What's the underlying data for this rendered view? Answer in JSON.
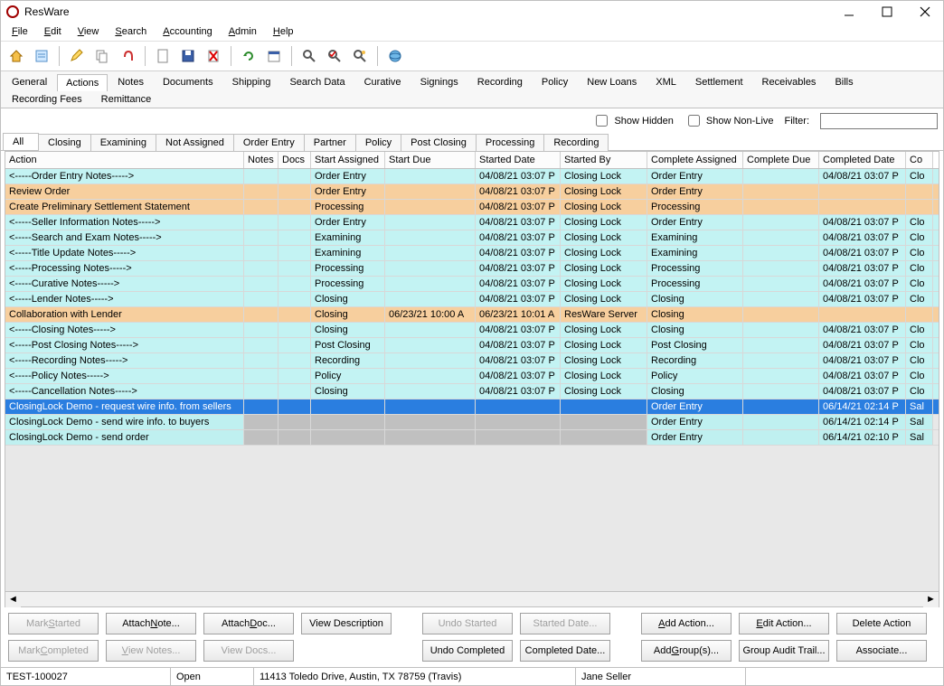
{
  "title": "ResWare",
  "menus": [
    "File",
    "Edit",
    "View",
    "Search",
    "Accounting",
    "Admin",
    "Help"
  ],
  "main_tabs": [
    "General",
    "Actions",
    "Notes",
    "Documents",
    "Shipping",
    "Search Data",
    "Curative",
    "Signings",
    "Recording",
    "Policy",
    "New Loans",
    "XML",
    "Settlement",
    "Receivables",
    "Bills",
    "Recording Fees",
    "Remittance"
  ],
  "active_main_tab": "Actions",
  "filterbar": {
    "show_hidden": "Show Hidden",
    "show_nonlive": "Show Non-Live",
    "filter_label": "Filter:",
    "filter_value": ""
  },
  "sub_tabs": [
    "All",
    "Closing",
    "Examining",
    "Not Assigned",
    "Order Entry",
    "Partner",
    "Policy",
    "Post Closing",
    "Processing",
    "Recording"
  ],
  "active_sub_tab": "All",
  "columns": [
    "Action",
    "Notes",
    "Docs",
    "Start Assigned",
    "Start Due",
    "Started Date",
    "Started By",
    "Complete Assigned",
    "Complete Due",
    "Completed Date",
    "Co"
  ],
  "rows": [
    {
      "cls": "row-teal",
      "action": "<-----Order Entry Notes----->",
      "startassigned": "Order Entry",
      "starteddate": "04/08/21 03:07 P",
      "startedby": "Closing Lock",
      "compassigned": "Order Entry",
      "compdate": "04/08/21 03:07 P",
      "co": "Clo"
    },
    {
      "cls": "row-orange",
      "action": "Review Order",
      "startassigned": "Order Entry",
      "starteddate": "04/08/21 03:07 P",
      "startedby": "Closing Lock",
      "compassigned": "Order Entry"
    },
    {
      "cls": "row-orange",
      "action": "Create Preliminary Settlement Statement",
      "startassigned": "Processing",
      "starteddate": "04/08/21 03:07 P",
      "startedby": "Closing Lock",
      "compassigned": "Processing"
    },
    {
      "cls": "row-teal",
      "action": "<-----Seller Information Notes----->",
      "startassigned": "Order Entry",
      "starteddate": "04/08/21 03:07 P",
      "startedby": "Closing Lock",
      "compassigned": "Order Entry",
      "compdate": "04/08/21 03:07 P",
      "co": "Clo"
    },
    {
      "cls": "row-teal",
      "action": "<-----Search and Exam Notes----->",
      "startassigned": "Examining",
      "starteddate": "04/08/21 03:07 P",
      "startedby": "Closing Lock",
      "compassigned": "Examining",
      "compdate": "04/08/21 03:07 P",
      "co": "Clo"
    },
    {
      "cls": "row-teal",
      "action": "<-----Title Update Notes----->",
      "startassigned": "Examining",
      "starteddate": "04/08/21 03:07 P",
      "startedby": "Closing Lock",
      "compassigned": "Examining",
      "compdate": "04/08/21 03:07 P",
      "co": "Clo"
    },
    {
      "cls": "row-teal",
      "action": "<-----Processing Notes----->",
      "startassigned": "Processing",
      "starteddate": "04/08/21 03:07 P",
      "startedby": "Closing Lock",
      "compassigned": "Processing",
      "compdate": "04/08/21 03:07 P",
      "co": "Clo"
    },
    {
      "cls": "row-teal",
      "action": "<-----Curative Notes----->",
      "startassigned": "Processing",
      "starteddate": "04/08/21 03:07 P",
      "startedby": "Closing Lock",
      "compassigned": "Processing",
      "compdate": "04/08/21 03:07 P",
      "co": "Clo"
    },
    {
      "cls": "row-teal",
      "action": "<-----Lender Notes----->",
      "startassigned": "Closing",
      "starteddate": "04/08/21 03:07 P",
      "startedby": "Closing Lock",
      "compassigned": "Closing",
      "compdate": "04/08/21 03:07 P",
      "co": "Clo"
    },
    {
      "cls": "row-orange",
      "action": "Collaboration with Lender",
      "startassigned": "Closing",
      "startdue": "06/23/21 10:00 A",
      "starteddate": "06/23/21 10:01 A",
      "startedby": "ResWare Server",
      "compassigned": "Closing"
    },
    {
      "cls": "row-teal",
      "action": "<-----Closing Notes----->",
      "startassigned": "Closing",
      "starteddate": "04/08/21 03:07 P",
      "startedby": "Closing Lock",
      "compassigned": "Closing",
      "compdate": "04/08/21 03:07 P",
      "co": "Clo"
    },
    {
      "cls": "row-teal",
      "action": "<-----Post Closing Notes----->",
      "startassigned": "Post Closing",
      "starteddate": "04/08/21 03:07 P",
      "startedby": "Closing Lock",
      "compassigned": "Post Closing",
      "compdate": "04/08/21 03:07 P",
      "co": "Clo"
    },
    {
      "cls": "row-teal",
      "action": "<-----Recording Notes----->",
      "startassigned": "Recording",
      "starteddate": "04/08/21 03:07 P",
      "startedby": "Closing Lock",
      "compassigned": "Recording",
      "compdate": "04/08/21 03:07 P",
      "co": "Clo"
    },
    {
      "cls": "row-teal",
      "action": "<-----Policy Notes----->",
      "startassigned": "Policy",
      "starteddate": "04/08/21 03:07 P",
      "startedby": "Closing Lock",
      "compassigned": "Policy",
      "compdate": "04/08/21 03:07 P",
      "co": "Clo"
    },
    {
      "cls": "row-teal",
      "action": "<-----Cancellation Notes----->",
      "startassigned": "Closing",
      "starteddate": "04/08/21 03:07 P",
      "startedby": "Closing Lock",
      "compassigned": "Closing",
      "compdate": "04/08/21 03:07 P",
      "co": "Clo"
    },
    {
      "cls": "row-selected",
      "action": "ClosingLock Demo - request wire info. from sellers",
      "compassigned": "Order Entry",
      "compdate": "06/14/21 02:14 P",
      "co": "Sal"
    },
    {
      "cls": "",
      "action": "ClosingLock Demo - send wire info. to buyers",
      "notes_cls": "row-gray",
      "docs_cls": "row-gray",
      "startassigned_cls": "row-gray",
      "startdue_cls": "row-gray",
      "starteddate_cls": "row-gray",
      "startedby_cls": "row-gray",
      "compassigned": "Order Entry",
      "compdate": "06/14/21 02:14 P",
      "co": "Sal",
      "action_cls": "row-ltteal",
      "compassigned_cls": "row-ltteal",
      "compdue_cls": "row-ltteal",
      "compdate_cls": "row-ltteal",
      "co_cls": "row-ltteal"
    },
    {
      "cls": "",
      "action": "ClosingLock Demo - send order",
      "notes_cls": "row-gray",
      "docs_cls": "row-gray",
      "startassigned_cls": "row-gray",
      "startdue_cls": "row-gray",
      "starteddate_cls": "row-gray",
      "startedby_cls": "row-gray",
      "compassigned": "Order Entry",
      "compdate": "06/14/21 02:10 P",
      "co": "Sal",
      "action_cls": "row-ltteal",
      "compassigned_cls": "row-ltteal",
      "compdue_cls": "row-ltteal",
      "compdate_cls": "row-ltteal",
      "co_cls": "row-ltteal"
    }
  ],
  "buttons_row1": [
    {
      "label": "Mark Started",
      "disabled": true,
      "u": "S"
    },
    {
      "label": "Attach Note...",
      "u": "N"
    },
    {
      "label": "Attach Doc...",
      "u": "D"
    },
    {
      "label": "View Description",
      "u": ""
    },
    {
      "gap": true
    },
    {
      "label": "Undo Started",
      "disabled": true,
      "u": ""
    },
    {
      "label": "Started Date...",
      "disabled": true,
      "u": ""
    },
    {
      "gap": true
    },
    {
      "label": "Add Action...",
      "u": "A"
    },
    {
      "label": "Edit Action...",
      "u": "E"
    },
    {
      "label": "Delete Action",
      "u": ""
    }
  ],
  "buttons_row2": [
    {
      "label": "Mark Completed",
      "disabled": true,
      "u": "C"
    },
    {
      "label": "View Notes...",
      "disabled": true,
      "u": "V"
    },
    {
      "label": "View Docs...",
      "disabled": true,
      "u": ""
    },
    {
      "spacer": true
    },
    {
      "gap": true
    },
    {
      "label": "Undo Completed",
      "u": ""
    },
    {
      "label": "Completed Date...",
      "u": ""
    },
    {
      "gap": true
    },
    {
      "label": "Add Group(s)...",
      "u": "G"
    },
    {
      "label": "Group Audit Trail...",
      "u": ""
    },
    {
      "label": "Associate...",
      "u": ""
    }
  ],
  "status": {
    "fileno": "TEST-100027",
    "status": "Open",
    "address": "11413 Toledo Drive, Austin, TX  78759 (Travis)",
    "contact": "Jane Seller"
  }
}
